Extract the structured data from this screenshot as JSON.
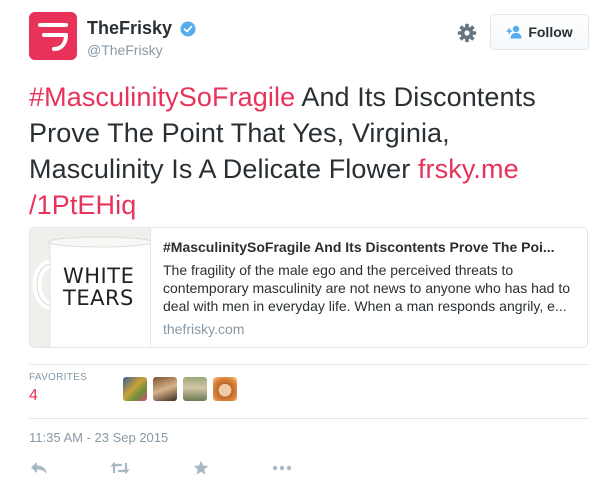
{
  "profile": {
    "name": "TheFrisky",
    "handle": "@TheFrisky",
    "verified": true,
    "avatar_color": "#e8325a"
  },
  "follow_button": {
    "label": "Follow",
    "icon": "add-user-icon"
  },
  "settings_icon": "gear-icon",
  "tweet": {
    "hashtag": "#MasculinitySoFragile",
    "text": " And Its Discontents Prove The Point That Yes, Virginia, Masculinity Is A Delicate Flower ",
    "link_line1": "frsky.me",
    "link_line2": "/1PtEHiq"
  },
  "card": {
    "image_text_line1": "WHITE",
    "image_text_line2": "TEARS",
    "title": "#MasculinitySoFragile And Its Discontents Prove The Poi...",
    "description": "The fragility of the male ego and the perceived threats to contemporary masculinity are not news to anyone who has had to deal with men in everyday life. When a man responds angrily, e...",
    "domain": "thefrisky.com"
  },
  "stats": {
    "favorites_label": "FAVORITES",
    "favorites_count": "4"
  },
  "timestamp": "11:35 AM - 23 Sep 2015",
  "actions": [
    "reply-icon",
    "retweet-icon",
    "favorite-icon",
    "more-icon"
  ],
  "colors": {
    "accent": "#e8325a",
    "muted": "#8899a6",
    "border": "#e1e8ed",
    "verified": "#55acee"
  }
}
